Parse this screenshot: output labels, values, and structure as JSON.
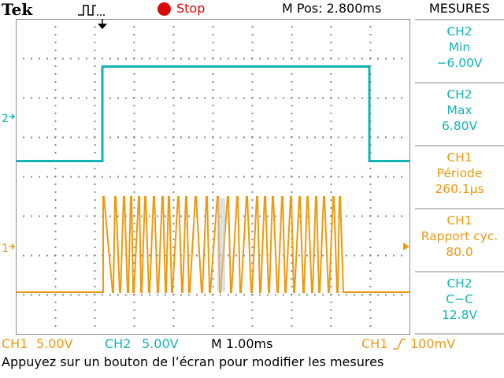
{
  "header": {
    "brand": "Tek",
    "run_state": "Stop",
    "m_pos": "M Pos: 2.800ms",
    "menu_title": "MESURES"
  },
  "colors": {
    "ch1": "#eb9a12",
    "ch2": "#12b3b6",
    "stop": "#d90a0a",
    "grid": "#8a8a8a"
  },
  "markers": {
    "ch2_ground": "2",
    "ch1_ground": "1"
  },
  "measurements": [
    {
      "channel": "CH2",
      "label": "Min",
      "value": "−6.00V",
      "color": "ch2"
    },
    {
      "channel": "CH2",
      "label": "Max",
      "value": "6.80V",
      "color": "ch2"
    },
    {
      "channel": "CH1",
      "label": "Période",
      "value": "260.1µs",
      "color": "ch1"
    },
    {
      "channel": "CH1",
      "label": "Rapport cyc.",
      "value": "80.0",
      "color": "ch1"
    },
    {
      "channel": "CH2",
      "label": "C−C",
      "value": "12.8V",
      "color": "ch2"
    }
  ],
  "status": {
    "ch1_label": "CH1",
    "ch1_scale": "5.00V",
    "ch2_label": "CH2",
    "ch2_scale": "5.00V",
    "timebase": "M 1.00ms",
    "trigger_source": "CH1",
    "trigger_level": "100mV"
  },
  "prompt": "Appuyez sur un bouton de l’écran pour modifier les mesures"
}
